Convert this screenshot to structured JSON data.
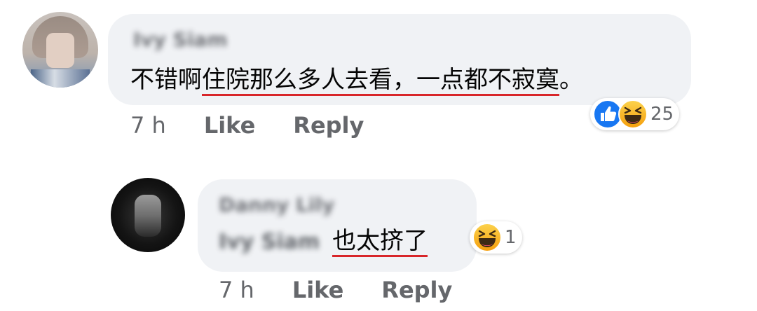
{
  "comments": [
    {
      "author": "Ivy Siam",
      "text": "不错啊住院那么多人去看，一点都不寂寞。",
      "text_prefix": "不错啊",
      "text_underlined": "住院那么多人去看，一点都不寂寞",
      "text_suffix": "。",
      "time": "7 h",
      "like_label": "Like",
      "reply_label": "Reply",
      "reactions": [
        "like-icon",
        "haha-icon"
      ],
      "reaction_count": "25"
    },
    {
      "author": "Danny Lily",
      "mention": "Ivy Siam",
      "text": "也太挤了",
      "time": "7 h",
      "like_label": "Like",
      "reply_label": "Reply",
      "reactions": [
        "haha-icon"
      ],
      "reaction_count": "1"
    }
  ],
  "colors": {
    "bubble_bg": "#f0f2f5",
    "action_text": "#65676b",
    "underline": "#d8262a",
    "like_blue": "#1877f2",
    "haha_yellow": "#f7b125"
  }
}
